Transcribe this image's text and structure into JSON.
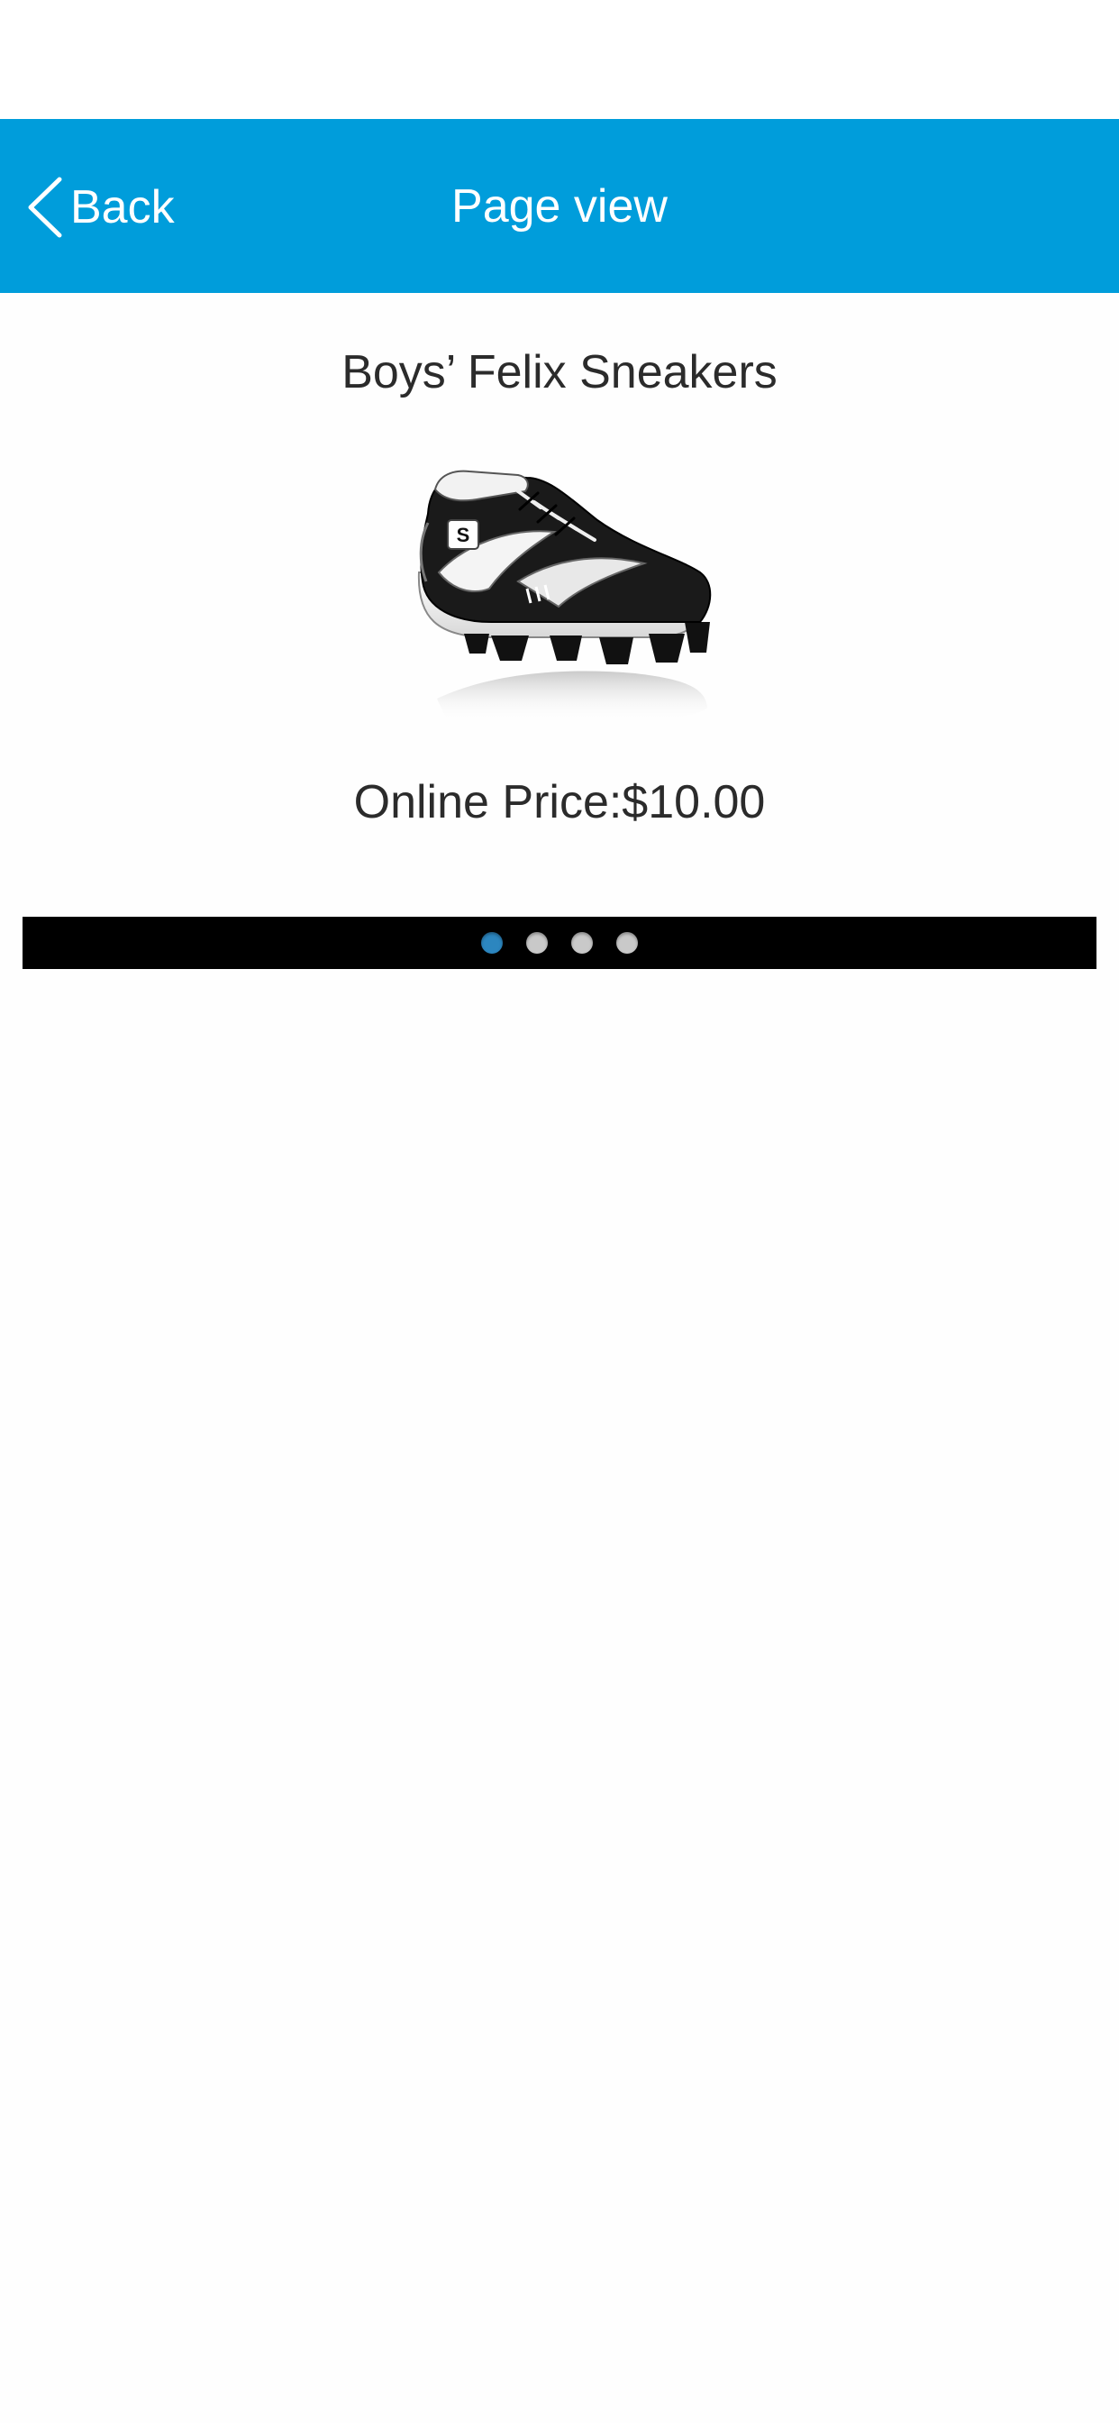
{
  "nav": {
    "back_label": "Back",
    "title": "Page view",
    "bar_color": "#009ddb"
  },
  "product": {
    "title": "Boys’ Felix Sneakers",
    "image_icon": "sneaker-image",
    "price_text": "Online Price:$10.00"
  },
  "pager": {
    "page_count": 4,
    "active_index": 0,
    "active_color": "#2c86bf",
    "inactive_color": "#c9c9c9"
  }
}
